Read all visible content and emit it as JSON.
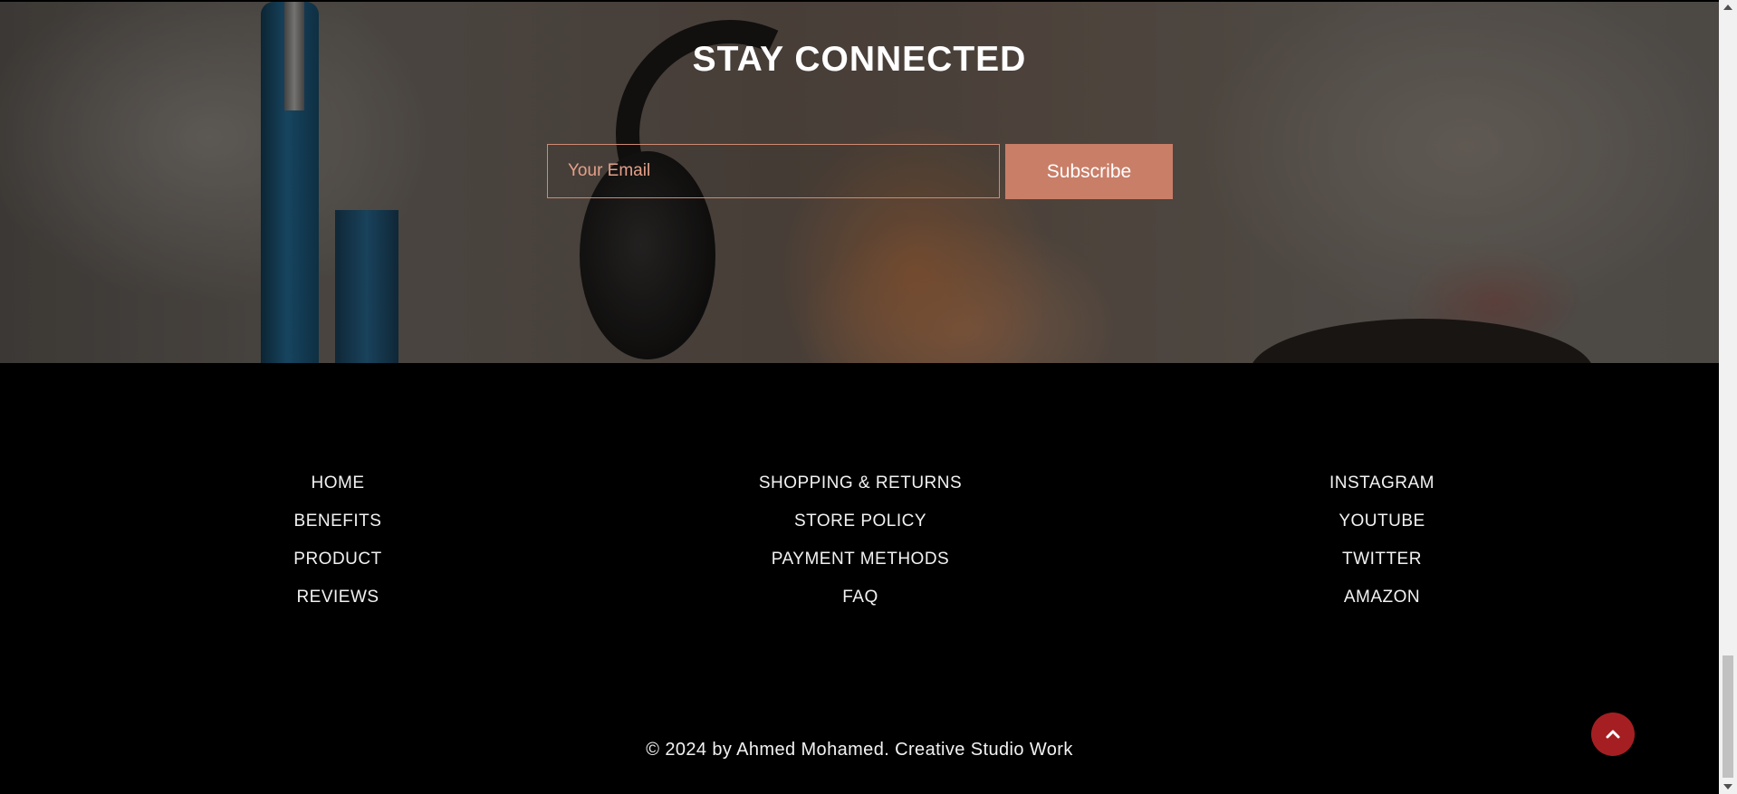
{
  "newsletter": {
    "title": "STAY CONNECTED",
    "email_placeholder": "Your Email",
    "subscribe_label": "Subscribe"
  },
  "footer": {
    "nav_main": [
      "HOME",
      "BENEFITS",
      "PRODUCT",
      "REVIEWS"
    ],
    "nav_info": [
      "SHOPPING & RETURNS",
      "STORE POLICY",
      "PAYMENT METHODS",
      "FAQ"
    ],
    "nav_social": [
      "INSTAGRAM",
      "YOUTUBE",
      "TWITTER",
      "AMAZON"
    ],
    "copyright": "© 2024 by Ahmed Mohamed. Creative Studio Work"
  },
  "back_to_top": {
    "icon": "chevron-up-icon",
    "color": "#a51f22"
  },
  "colors": {
    "accent": "#c97e68",
    "input_border": "#d08a72",
    "footer_bg": "#000000",
    "text_light": "#f2f2f2"
  }
}
